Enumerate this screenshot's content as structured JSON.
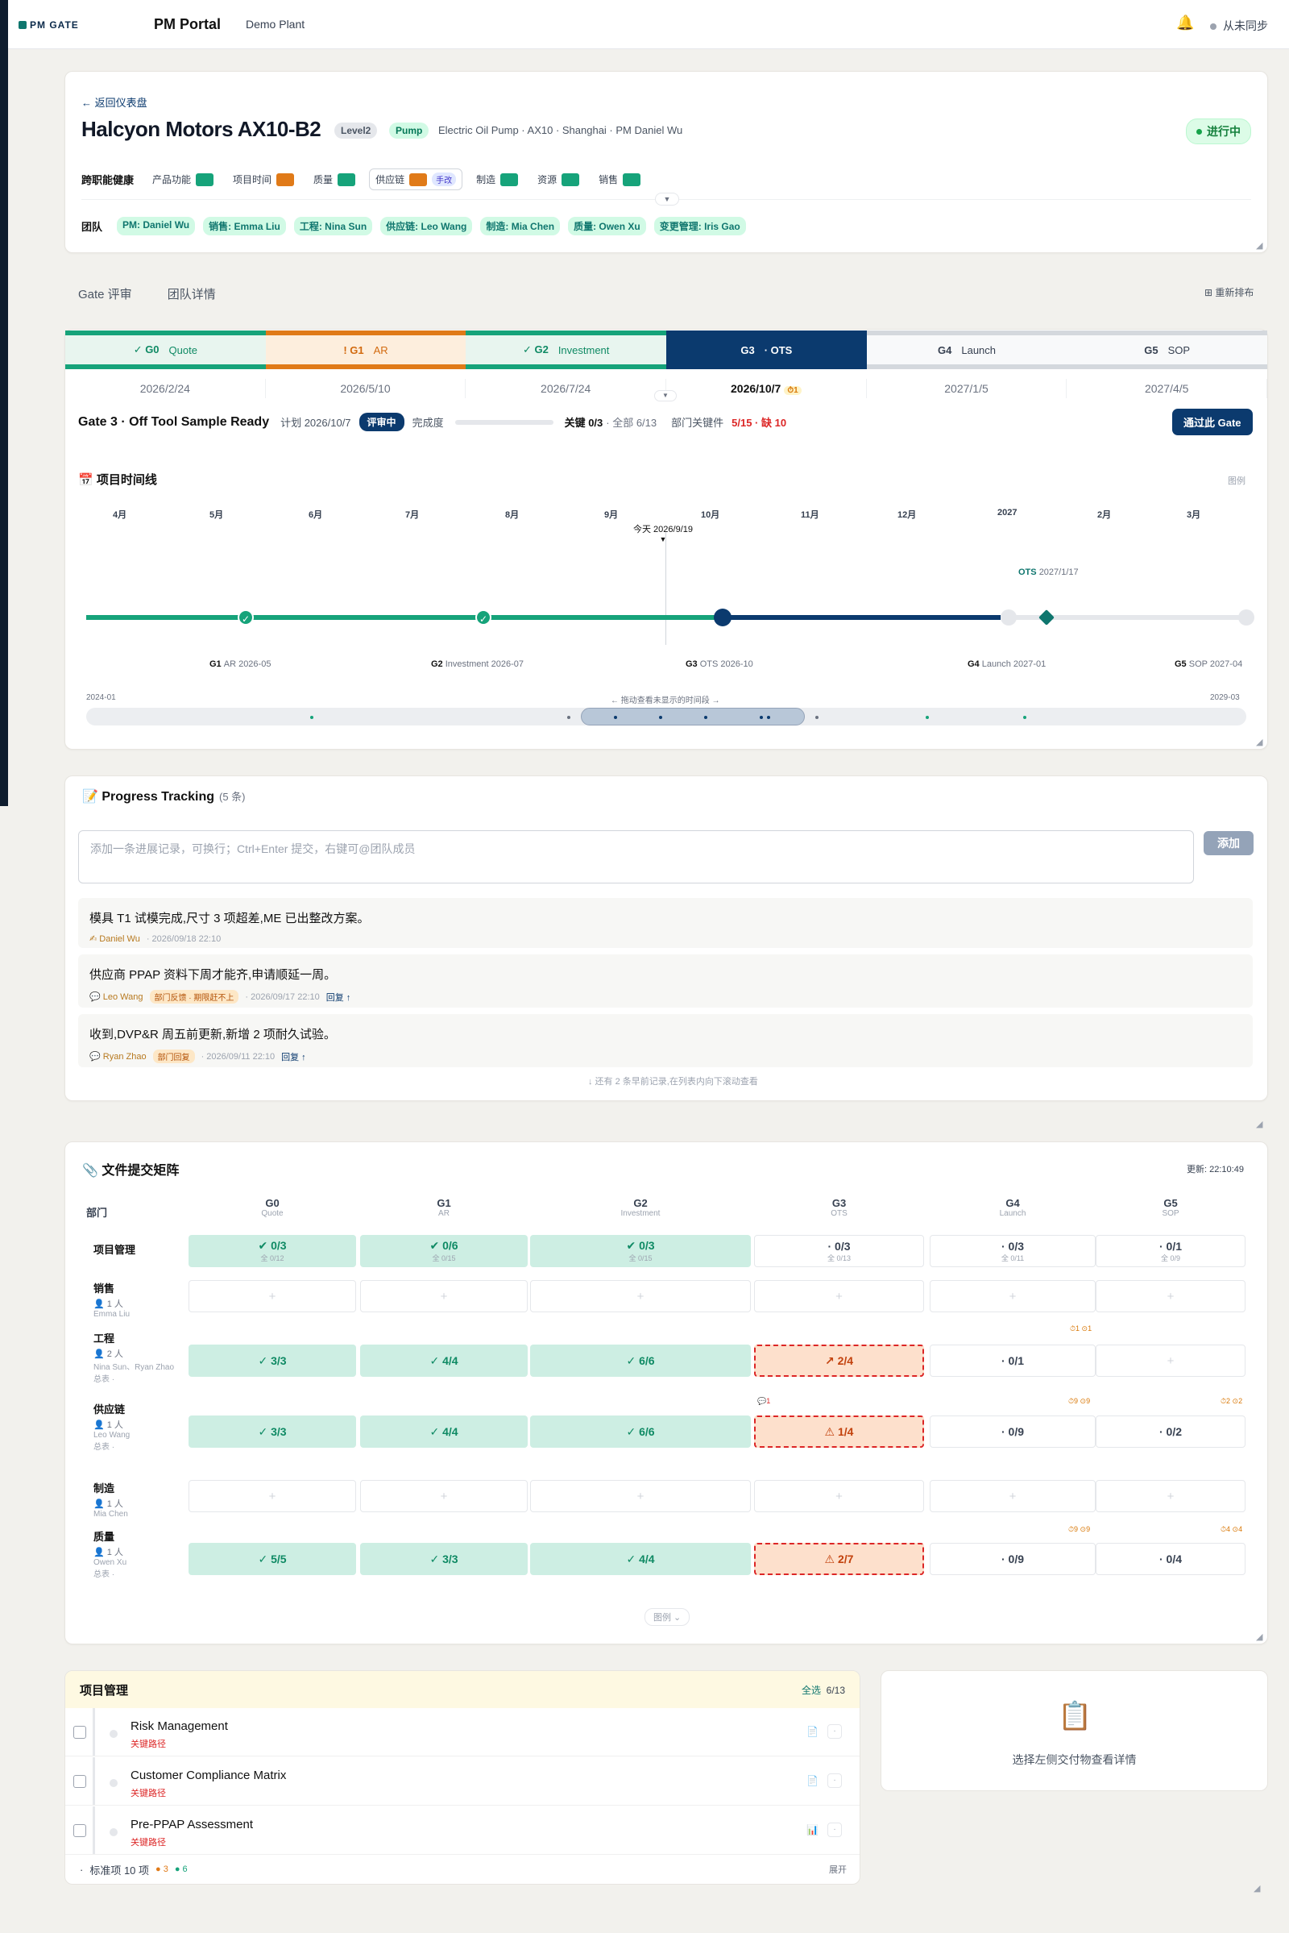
{
  "topbar": {
    "logo": "PM GATE",
    "portal": "PM Portal",
    "plant": "Demo Plant",
    "sync": "从未同步"
  },
  "header": {
    "back": "← 返回仪表盘",
    "title": "Halcyon Motors AX10-B2",
    "level": "Level2",
    "type": "Pump",
    "meta": "Electric Oil Pump · AX10 · Shanghai · PM Daniel Wu",
    "status": "进行中",
    "health_label": "跨职能健康",
    "health": [
      {
        "label": "产品功能",
        "color": "#16a37a"
      },
      {
        "label": "项目时间",
        "color": "#e07a18"
      },
      {
        "label": "质量",
        "color": "#16a37a"
      },
      {
        "label": "供应链",
        "color": "#e07a18",
        "tag": "手改"
      },
      {
        "label": "制造",
        "color": "#16a37a"
      },
      {
        "label": "资源",
        "color": "#16a37a"
      },
      {
        "label": "销售",
        "color": "#16a37a"
      }
    ],
    "team_label": "团队",
    "team": [
      "PM: Daniel Wu",
      "销售: Emma Liu",
      "工程: Nina Sun",
      "供应链: Leo Wang",
      "制造: Mia Chen",
      "质量: Owen Xu",
      "变更管理: Iris Gao"
    ]
  },
  "tabs": [
    "Gate 评审",
    "团队详情"
  ],
  "rearrange": "重新排布",
  "gates": [
    {
      "label": "✓ G0",
      "name": "Quote",
      "date": "2026/2/24",
      "state": "done"
    },
    {
      "label": "! G1",
      "name": "AR",
      "date": "2026/5/10",
      "state": "warn"
    },
    {
      "label": "✓ G2",
      "name": "Investment",
      "date": "2026/7/24",
      "state": "done"
    },
    {
      "label": "G3",
      "name": "· OTS",
      "date": "2026/10/7",
      "state": "cur",
      "badge": "⏱1"
    },
    {
      "label": "G4",
      "name": "Launch",
      "date": "2027/1/5",
      "state": "fut"
    },
    {
      "label": "G5",
      "name": "SOP",
      "date": "2027/4/5",
      "state": "fut"
    }
  ],
  "gate_detail": {
    "title": "Gate 3 · Off Tool Sample Ready",
    "plan": "计划 2026/10/7",
    "review": "评审中",
    "completion_label": "完成度",
    "completion": 0,
    "critical": "关键 0/3",
    "all": "· 全部 6/13",
    "dept_label": "部门关键件",
    "dept_value": "5/15 · 缺 10",
    "pass": "通过此 Gate"
  },
  "timeline": {
    "title": "📅 项目时间线",
    "legend": "图例",
    "months": [
      "4月",
      "5月",
      "6月",
      "7月",
      "8月",
      "9月",
      "10月",
      "11月",
      "12月",
      "2027",
      "2月",
      "3月"
    ],
    "today": "今天 2026/9/19",
    "gates": [
      {
        "g": "G1",
        "name": "AR 2026-05"
      },
      {
        "g": "G2",
        "name": "Investment 2026-07"
      },
      {
        "g": "G3",
        "name": "OTS 2026-10"
      },
      {
        "g": "G4",
        "name": "Launch 2027-01"
      },
      {
        "g": "G5",
        "name": "SOP 2027-04"
      }
    ],
    "ots": {
      "g": "OTS",
      "d": "2027/1/17"
    },
    "range_start": "2024-01",
    "range_end": "2029-03",
    "drag_hint": "← 拖动查看未显示的时间段 →"
  },
  "progress": {
    "title": "📝 Progress Tracking",
    "count": "(5 条)",
    "placeholder": "添加一条进展记录，可换行；Ctrl+Enter 提交，右键可@团队成员",
    "add": "添加",
    "entries": [
      {
        "text": "模具 T1 试模完成,尺寸 3 项超差,ME 已出整改方案。",
        "author": "✍ Daniel Wu",
        "time": "· 2026/09/18 22:10"
      },
      {
        "text": "供应商 PPAP 资料下周才能齐,申请顺延一周。",
        "author": "💬 Leo Wang",
        "chip": "部门反馈 · 期限赶不上",
        "time": "· 2026/09/17 22:10",
        "reply": "回复 ↑"
      },
      {
        "text": "收到,DVP&R 周五前更新,新增 2 项耐久试验。",
        "author": "💬 Ryan Zhao",
        "chip": "部门回复",
        "time": "· 2026/09/11 22:10",
        "reply": "回复 ↑"
      }
    ],
    "more": "↓ 还有 2 条早前记录,在列表内向下滚动查看"
  },
  "matrix": {
    "title": "📎 文件提交矩阵",
    "updated": "更新: 22:10:49",
    "dept_col": "部门",
    "cols": [
      {
        "g": "G0",
        "n": "Quote"
      },
      {
        "g": "G1",
        "n": "AR"
      },
      {
        "g": "G2",
        "n": "Investment"
      },
      {
        "g": "G3",
        "n": "OTS"
      },
      {
        "g": "G4",
        "n": "Launch"
      },
      {
        "g": "G5",
        "n": "SOP"
      }
    ],
    "rows": [
      {
        "name": "项目管理",
        "people": "",
        "names": "",
        "link": "",
        "cells": [
          "✔ 0/3|全 0/12",
          "✔ 0/6|全 0/15",
          "✔ 0/3|全 0/15",
          "· 0/3|全 0/13",
          "· 0/3|全 0/11",
          "· 0/1|全 0/9"
        ]
      },
      {
        "name": "销售",
        "people": "👤 1 人",
        "names": "Emma Liu",
        "link": "",
        "cells": [
          "+",
          "+",
          "+",
          "+",
          "+",
          "+"
        ]
      },
      {
        "name": "工程",
        "people": "👤 2 人",
        "names": "Nina Sun、Ryan Zhao",
        "link": "总表 ·",
        "cells": [
          "✓ 3/3",
          "✓ 4/4",
          "✓ 6/6",
          "↗ 2/4",
          "· 0/1",
          "+"
        ]
      },
      {
        "name": "供应链",
        "people": "👤 1 人",
        "names": "Leo Wang",
        "link": "总表 ·",
        "cells": [
          "✓ 3/3",
          "✓ 4/4",
          "✓ 6/6",
          "⚠ 1/4",
          "· 0/9",
          "· 0/2"
        ]
      },
      {
        "name": "制造",
        "people": "👤 1 人",
        "names": "Mia Chen",
        "link": "",
        "cells": [
          "+",
          "+",
          "+",
          "+",
          "+",
          "+"
        ]
      },
      {
        "name": "质量",
        "people": "👤 1 人",
        "names": "Owen Xu",
        "link": "总表 ·",
        "cells": [
          "✓ 5/5",
          "✓ 3/3",
          "✓ 4/4",
          "⚠ 2/7",
          "· 0/9",
          "· 0/4"
        ]
      }
    ],
    "marks": [
      "⏱1 ⊙1",
      "💬1",
      "⏱9 ⊙9",
      "⏱2 ⊙2",
      "⏱9 ⊙9",
      "⏱4 ⊙4"
    ],
    "legend": "图例 ⌄"
  },
  "pm": {
    "title": "项目管理",
    "select_all": "全选",
    "count": "6/13",
    "items": [
      {
        "name": "Risk Management",
        "crit": "关键路径",
        "icon": "📄"
      },
      {
        "name": "Customer Compliance Matrix",
        "crit": "关键路径",
        "icon": "📄"
      },
      {
        "name": "Pre-PPAP Assessment",
        "crit": "关键路径",
        "icon": "📊"
      }
    ],
    "footer": "标准项 10 项",
    "f1": "● 3",
    "f2": "● 6",
    "expand": "展开"
  },
  "detail": {
    "icon": "📋",
    "text": "选择左侧交付物查看详情"
  }
}
